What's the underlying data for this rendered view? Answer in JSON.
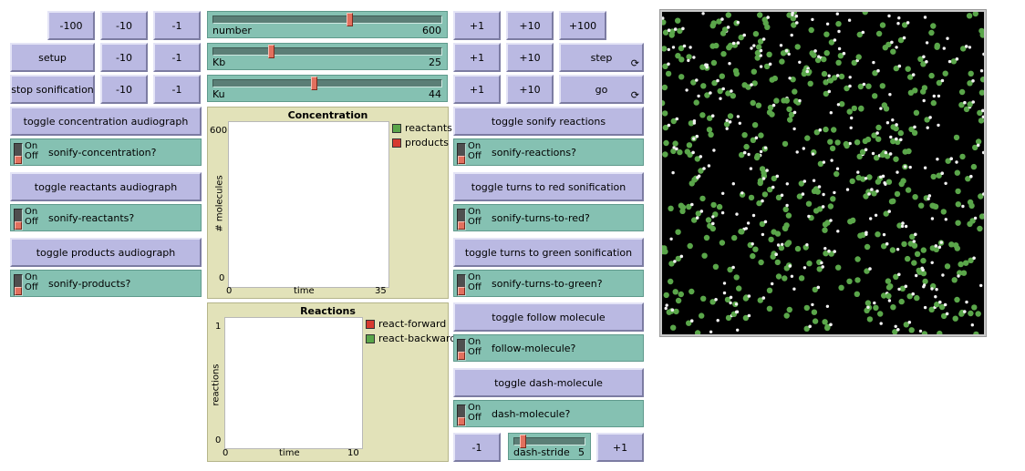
{
  "left_buttons": {
    "r1": [
      "-100",
      "-10",
      "-1"
    ],
    "setup": "setup",
    "r2": [
      "-10",
      "-1"
    ],
    "stop_sonification": "stop sonification",
    "r3": [
      "-10",
      "-1"
    ]
  },
  "sliders": {
    "number": {
      "label": "number",
      "value": "600",
      "fraction": 0.6
    },
    "kb": {
      "label": "Kb",
      "value": "25",
      "fraction": 0.25
    },
    "ku": {
      "label": "Ku",
      "value": "44",
      "fraction": 0.44
    },
    "dash_stride": {
      "label": "dash-stride",
      "value": "5",
      "fraction": 0.1
    }
  },
  "right_small_buttons": {
    "r1": [
      "+1",
      "+10",
      "+100"
    ],
    "r2": [
      "+1",
      "+10"
    ],
    "r3": [
      "+1",
      "+10"
    ]
  },
  "step": "step",
  "go": "go",
  "left_toggles": [
    {
      "button": "toggle concentration audiograph",
      "switch": "sonify-concentration?"
    },
    {
      "button": "toggle reactants audiograph",
      "switch": "sonify-reactants?"
    },
    {
      "button": "toggle products audiograph",
      "switch": "sonify-products?"
    }
  ],
  "right_toggles": [
    {
      "button": "toggle sonify reactions",
      "switch": "sonify-reactions?"
    },
    {
      "button": "toggle turns to red sonification",
      "switch": "sonify-turns-to-red?"
    },
    {
      "button": "toggle turns to green sonification",
      "switch": "sonify-turns-to-green?"
    },
    {
      "button": "toggle follow molecule",
      "switch": "follow-molecule?"
    },
    {
      "button": "toggle dash-molecule",
      "switch": "dash-molecule?"
    }
  ],
  "switch_on": "On",
  "switch_off": "Off",
  "dash_minus": "-1",
  "dash_plus": "+1",
  "colors": {
    "green": "#5aa64a",
    "red": "#d63a2f",
    "white": "#f2f2f2"
  },
  "plots": {
    "concentration": {
      "title": "Concentration",
      "ylabel": "# molecules",
      "xlabel": "time",
      "xmin": "0",
      "xmax": "35",
      "ymin": "0",
      "ymax": "600",
      "legend": [
        {
          "name": "reactants",
          "color": "#5aa64a"
        },
        {
          "name": "products",
          "color": "#d63a2f"
        }
      ]
    },
    "reactions": {
      "title": "Reactions",
      "ylabel": "reactions",
      "xlabel": "time",
      "xmin": "0",
      "xmax": "10",
      "ymin": "0",
      "ymax": "1",
      "legend": [
        {
          "name": "react-forward",
          "color": "#d63a2f"
        },
        {
          "name": "react-backward",
          "color": "#5aa64a"
        }
      ]
    }
  },
  "world": {
    "green_molecules": 480,
    "white_particles": 170,
    "seed": 7
  }
}
